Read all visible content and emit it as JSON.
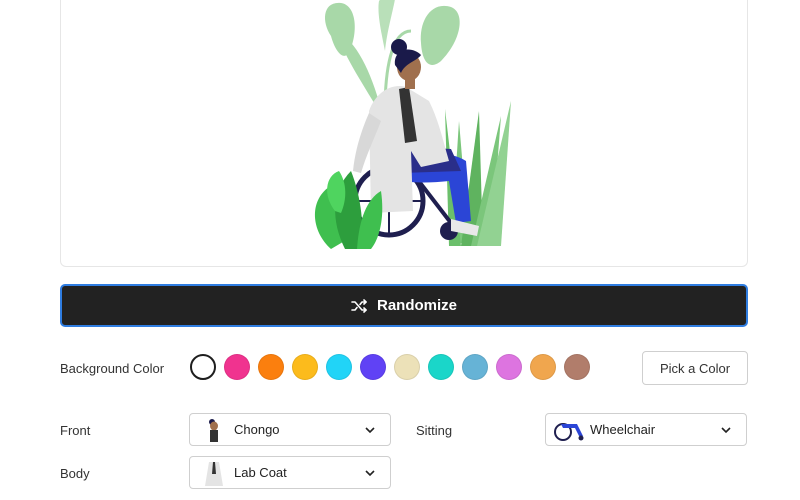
{
  "randomize": {
    "label": "Randomize",
    "icon": "shuffle-icon"
  },
  "background": {
    "label": "Background Color",
    "swatches": [
      "#ffffff",
      "#f0338f",
      "#fb7f0e",
      "#fcbb1c",
      "#21d4f7",
      "#6042f5",
      "#ece1b8",
      "#1ad6c9",
      "#66b3d6",
      "#dd74e0",
      "#f0a64e",
      "#b17d6b"
    ],
    "selected_index": 0,
    "pick_label": "Pick a Color"
  },
  "front": {
    "label": "Front",
    "value": "Chongo"
  },
  "sitting": {
    "label": "Sitting",
    "value": "Wheelchair"
  },
  "body": {
    "label": "Body",
    "value": "Lab Coat"
  }
}
